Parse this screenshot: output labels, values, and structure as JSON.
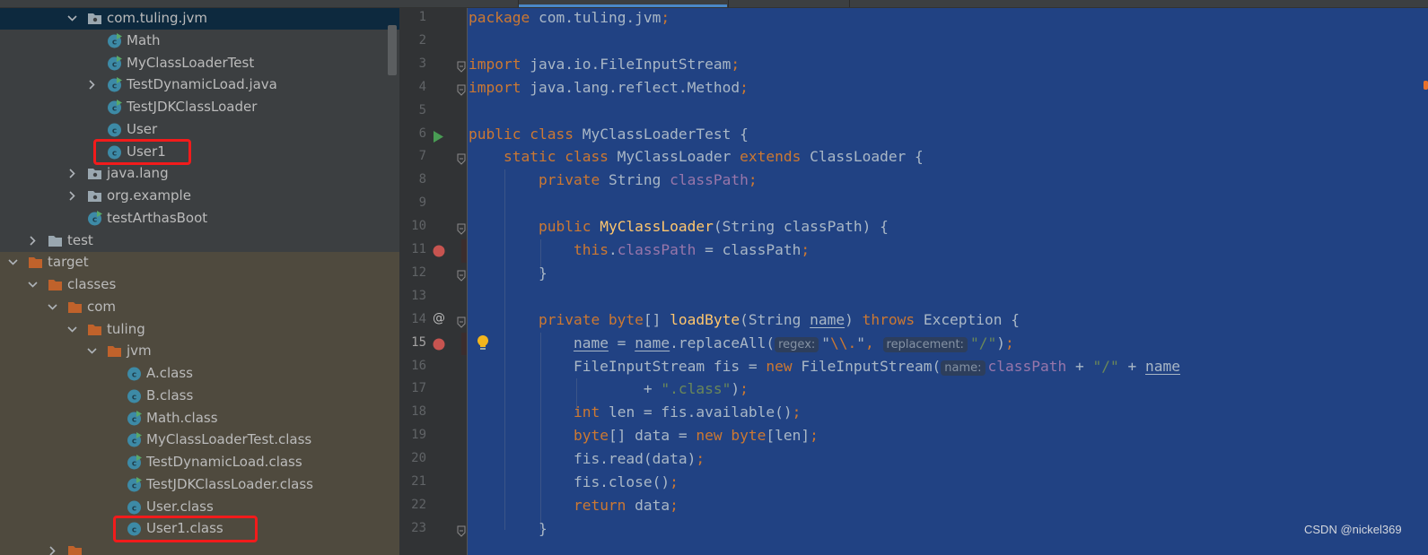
{
  "colors": {
    "editor_selection_bg": "#214283",
    "sidebar_bg": "#3c3f41",
    "target_folder_bg": "#4f4a3e",
    "selected_row_bg": "#0d293e",
    "highlight_box": "#f21b1b",
    "keyword": "#cc7832",
    "string": "#6a8759",
    "field": "#9876aa",
    "method_declaration": "#ffc66d"
  },
  "project_tree": [
    {
      "label": "com.tuling.jvm",
      "level": 3,
      "arrow": "down",
      "icon": "package-folder-icon",
      "selected": true
    },
    {
      "label": "Math",
      "level": 4,
      "arrow": null,
      "icon": "runnable-class-icon"
    },
    {
      "label": "MyClassLoaderTest",
      "level": 4,
      "arrow": null,
      "icon": "runnable-class-icon"
    },
    {
      "label": "TestDynamicLoad.java",
      "level": 4,
      "arrow": "right",
      "icon": "runnable-class-icon"
    },
    {
      "label": "TestJDKClassLoader",
      "level": 4,
      "arrow": null,
      "icon": "runnable-class-icon"
    },
    {
      "label": "User",
      "level": 4,
      "arrow": null,
      "icon": "class-icon"
    },
    {
      "label": "User1",
      "level": 4,
      "arrow": null,
      "icon": "class-icon",
      "highlighted": true
    },
    {
      "label": "java.lang",
      "level": 3,
      "arrow": "right",
      "icon": "package-folder-icon"
    },
    {
      "label": "org.example",
      "level": 3,
      "arrow": "right",
      "icon": "package-folder-icon"
    },
    {
      "label": "testArthasBoot",
      "level": 3,
      "arrow": null,
      "icon": "runnable-class-icon"
    },
    {
      "label": "test",
      "level": 1,
      "arrow": "right",
      "icon": "grey-folder-icon"
    },
    {
      "label": "target",
      "level": 0,
      "arrow": "down",
      "icon": "orange-folder-icon"
    },
    {
      "label": "classes",
      "level": 1,
      "arrow": "down",
      "icon": "orange-folder-icon"
    },
    {
      "label": "com",
      "level": 2,
      "arrow": "down",
      "icon": "orange-folder-icon"
    },
    {
      "label": "tuling",
      "level": 3,
      "arrow": "down",
      "icon": "orange-folder-icon"
    },
    {
      "label": "jvm",
      "level": 4,
      "arrow": "down",
      "icon": "orange-folder-icon"
    },
    {
      "label": "A.class",
      "level": 5,
      "arrow": null,
      "icon": "class-icon"
    },
    {
      "label": "B.class",
      "level": 5,
      "arrow": null,
      "icon": "class-icon"
    },
    {
      "label": "Math.class",
      "level": 5,
      "arrow": null,
      "icon": "runnable-class-icon"
    },
    {
      "label": "MyClassLoaderTest.class",
      "level": 5,
      "arrow": null,
      "icon": "runnable-class-icon"
    },
    {
      "label": "TestDynamicLoad.class",
      "level": 5,
      "arrow": null,
      "icon": "runnable-class-icon"
    },
    {
      "label": "TestJDKClassLoader.class",
      "level": 5,
      "arrow": null,
      "icon": "runnable-class-icon"
    },
    {
      "label": "User.class",
      "level": 5,
      "arrow": null,
      "icon": "class-icon"
    },
    {
      "label": "User1.class",
      "level": 5,
      "arrow": null,
      "icon": "class-icon",
      "highlighted": true
    },
    {
      "label": "",
      "level": 2,
      "arrow": "right",
      "icon": "orange-folder-icon"
    }
  ],
  "editor": {
    "current_line": 15,
    "gutter_marks": [
      {
        "line": 6,
        "icon": "run-icon"
      },
      {
        "line": 11,
        "icon": "breakpoint-icon"
      },
      {
        "line": 14,
        "icon": "override-at-icon"
      },
      {
        "line": 15,
        "icon": "breakpoint-icon"
      },
      {
        "line": 15,
        "icon": "lightbulb-icon"
      }
    ],
    "fold_lines": [
      3,
      4,
      7,
      10,
      12,
      14,
      23
    ],
    "lines": [
      [
        [
          "package",
          "kw"
        ],
        [
          " com.tuling.jvm",
          ""
        ],
        [
          ";",
          "kw"
        ]
      ],
      [],
      [
        [
          "import",
          "kw"
        ],
        [
          " java.io.FileInputStream",
          ""
        ],
        [
          ";",
          "kw"
        ]
      ],
      [
        [
          "import",
          "kw"
        ],
        [
          " java.lang.reflect.Method",
          ""
        ],
        [
          ";",
          "kw"
        ]
      ],
      [],
      [
        [
          "public class",
          "kw"
        ],
        [
          " MyClassLoaderTest {",
          ""
        ]
      ],
      [
        [
          "    ",
          ""
        ],
        [
          "static class",
          "kw"
        ],
        [
          " MyClassLoader ",
          ""
        ],
        [
          "extends",
          "kw"
        ],
        [
          " ClassLoader {",
          ""
        ]
      ],
      [
        [
          "        ",
          ""
        ],
        [
          "private",
          "kw"
        ],
        [
          " String ",
          ""
        ],
        [
          "classPath",
          "field"
        ],
        [
          ";",
          "kw"
        ]
      ],
      [],
      [
        [
          "        ",
          ""
        ],
        [
          "public",
          "kw"
        ],
        [
          " ",
          ""
        ],
        [
          "MyClassLoader",
          "mdecl"
        ],
        [
          "(String classPath) {",
          ""
        ]
      ],
      [
        [
          "            ",
          ""
        ],
        [
          "this",
          "kw"
        ],
        [
          ".",
          ""
        ],
        [
          "classPath",
          "field"
        ],
        [
          " = classPath",
          ""
        ],
        [
          ";",
          "kw"
        ]
      ],
      [
        [
          "        }",
          ""
        ]
      ],
      [],
      [
        [
          "        ",
          ""
        ],
        [
          "private byte",
          "kw"
        ],
        [
          "[] ",
          ""
        ],
        [
          "loadByte",
          "mdecl"
        ],
        [
          "(String ",
          ""
        ],
        [
          "name",
          "param"
        ],
        [
          ") ",
          ""
        ],
        [
          "throws",
          "kw"
        ],
        [
          " Exception {",
          ""
        ]
      ],
      [
        [
          "            ",
          ""
        ],
        [
          "name",
          "param"
        ],
        [
          " = ",
          ""
        ],
        [
          "name",
          "param"
        ],
        [
          ".replaceAll(",
          ""
        ],
        [
          "regex:",
          "hint"
        ],
        [
          "\"",
          ""
        ],
        [
          "\\\\.",
          "esc"
        ],
        [
          "\"",
          ""
        ],
        [
          ", ",
          "kw"
        ],
        [
          "replacement:",
          "hint"
        ],
        [
          "\"/\"",
          "str"
        ],
        [
          ")",
          ""
        ],
        [
          ";",
          "kw"
        ]
      ],
      [
        [
          "            FileInputStream fis = ",
          ""
        ],
        [
          "new",
          "kw"
        ],
        [
          " FileInputStream(",
          ""
        ],
        [
          "name:",
          "hint"
        ],
        [
          "classPath",
          "field"
        ],
        [
          " + ",
          ""
        ],
        [
          "\"/\"",
          "str"
        ],
        [
          " + ",
          ""
        ],
        [
          "name",
          "param"
        ]
      ],
      [
        [
          "                    + ",
          ""
        ],
        [
          "\".class\"",
          "str"
        ],
        [
          ")",
          ""
        ],
        [
          ";",
          "kw"
        ]
      ],
      [
        [
          "            ",
          ""
        ],
        [
          "int",
          "kw"
        ],
        [
          " len = fis.available()",
          ""
        ],
        [
          ";",
          "kw"
        ]
      ],
      [
        [
          "            ",
          ""
        ],
        [
          "byte",
          "kw"
        ],
        [
          "[] data = ",
          ""
        ],
        [
          "new byte",
          "kw"
        ],
        [
          "[len]",
          ""
        ],
        [
          ";",
          "kw"
        ]
      ],
      [
        [
          "            fis.read(data)",
          ""
        ],
        [
          ";",
          "kw"
        ]
      ],
      [
        [
          "            fis.close()",
          ""
        ],
        [
          ";",
          "kw"
        ]
      ],
      [
        [
          "            ",
          ""
        ],
        [
          "return",
          "kw"
        ],
        [
          " data",
          ""
        ],
        [
          ";",
          "kw"
        ]
      ],
      [
        [
          "        }",
          ""
        ]
      ]
    ]
  },
  "watermark": "CSDN @nickel369"
}
